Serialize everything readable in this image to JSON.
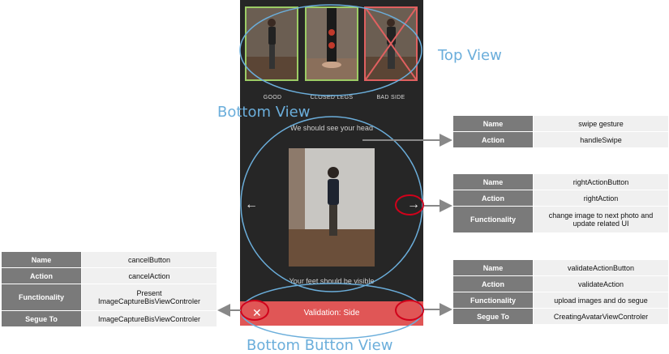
{
  "thumbnails": [
    {
      "label": "GOOD",
      "state": "good"
    },
    {
      "label": "CLOSED LEGS",
      "state": "good"
    },
    {
      "label": "BAD SIDE",
      "state": "bad"
    }
  ],
  "phone": {
    "instruction_top": "We should see your head",
    "instruction_bottom": "Your feet should be visible",
    "left_arrow": "←",
    "right_arrow": "→",
    "bottom_button_label": "Validation: Side",
    "cancel_glyph": "✕"
  },
  "view_labels": {
    "top": "Top View",
    "bottom": "Bottom View",
    "bottom_button": "Bottom Button View"
  },
  "tables": {
    "swipe": {
      "name_key": "Name",
      "name": "swipe gesture",
      "action_key": "Action",
      "action": "handleSwipe"
    },
    "right": {
      "name_key": "Name",
      "name": "rightActionButton",
      "action_key": "Action",
      "action": "rightAction",
      "func_key": "Functionality",
      "func": "change image to next photo and update related UI"
    },
    "cancel": {
      "name_key": "Name",
      "name": "cancelButton",
      "action_key": "Action",
      "action": "cancelAction",
      "func_key": "Functionality",
      "func": "Present ImageCaptureBisViewControler",
      "segue_key": "Segue To",
      "segue": "ImageCaptureBisViewControler"
    },
    "validate": {
      "name_key": "Name",
      "name": "validateActionButton",
      "action_key": "Action",
      "action": "validateAction",
      "func_key": "Functionality",
      "func": "upload images and do segue",
      "segue_key": "Segue To",
      "segue": "CreatingAvatarViewControler"
    }
  },
  "colors": {
    "accent": "#6baedb",
    "good_border": "#9ccc65",
    "bad": "#e05656",
    "highlight": "#d0021b"
  }
}
